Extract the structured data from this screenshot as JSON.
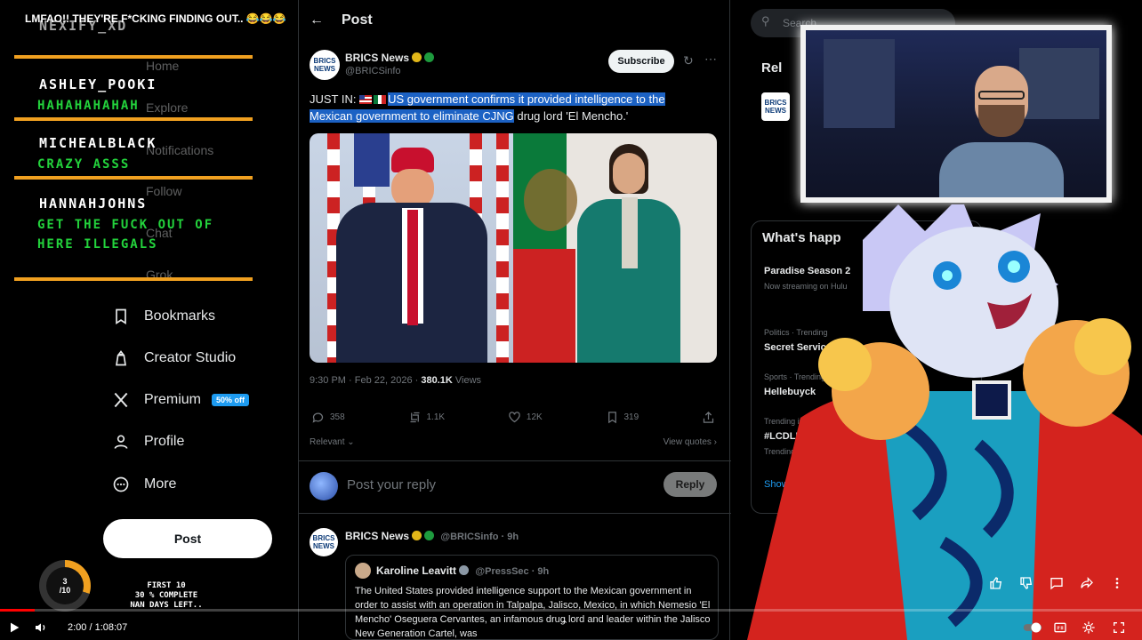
{
  "stream_title": "LMFAO!! THEY'RE F*CKING FINDING OUT.. 😂😂😂",
  "chat": {
    "header_name": "NEXIFY_XD",
    "messages": [
      {
        "user": "ASHLEY_POOKI",
        "text": "HAHAHAHAHAH"
      },
      {
        "user": "MICHEALBLACK",
        "text": "CRAZY ASSS"
      },
      {
        "user": "HANNAHJOHNS",
        "text": "GET THE FUCK OUT OF HERE ILLEGALS"
      }
    ],
    "accent_color": "#f0a020",
    "message_color": "#23d23c"
  },
  "sidebar": {
    "ghost_items": [
      "Home",
      "Explore",
      "Notifications",
      "Follow",
      "Chat",
      "Grok"
    ],
    "items": [
      {
        "label": "Bookmarks",
        "icon": "bookmark-icon"
      },
      {
        "label": "Creator Studio",
        "icon": "creator-studio-icon"
      },
      {
        "label": "Premium",
        "icon": "x-logo-icon",
        "badge": "50% off"
      },
      {
        "label": "Profile",
        "icon": "person-icon"
      },
      {
        "label": "More",
        "icon": "more-circle-icon"
      }
    ],
    "post_button": "Post"
  },
  "main": {
    "header_title": "Post",
    "post": {
      "author": "BRICS News",
      "handle": "@BRICSinfo",
      "subscribe": "Subscribe",
      "text_prefix": "JUST IN: ",
      "text_highlight": "US government confirms it provided intelligence to the Mexican government to eliminate CJNG",
      "text_suffix": " drug lord 'El Mencho.'",
      "time": "9:30 PM · Feb 22, 2026 · ",
      "views": "380.1K",
      "views_label": " Views",
      "replies": "358",
      "reposts": "1.1K",
      "likes": "12K",
      "bookmarks": "319",
      "relevant": "Relevant ⌄",
      "view_quotes": "View quotes ›"
    },
    "reply_placeholder": "Post your reply",
    "reply_button": "Reply",
    "second_post": {
      "author": "BRICS News",
      "handle": "@BRICSinfo · 9h",
      "quote_author": "Karoline Leavitt",
      "quote_handle": "@PressSec · 9h",
      "quote_text": "The United States provided intelligence support to the Mexican government in order to assist with an operation in Talpalpa, Jalisco, Mexico, in which Nemesio 'El Mencho' Oseguera Cervantes, an infamous drug lord and leader within the Jalisco New Generation Cartel, was"
    }
  },
  "right": {
    "search_placeholder": "Search",
    "relevant_head": "Rel",
    "whats_happening": "What's happ",
    "trends": [
      {
        "cat": "",
        "name": "Paradise Season 2",
        "sub": "Now streaming on Hulu"
      },
      {
        "cat": "Politics · Trending",
        "name": "Secret Service",
        "sub": ""
      },
      {
        "cat": "Sports · Trending",
        "name": "Hellebuyck",
        "sub": ""
      },
      {
        "cat": "Trending in United St",
        "name": "#LCDLF6",
        "sub": "Trending with"
      }
    ],
    "show_more": "Show more"
  },
  "goal": {
    "count": "3",
    "total": "/10",
    "percent": 30,
    "lines": [
      "FIRST 10",
      "30 % COMPLETE",
      "NAN DAYS LEFT.."
    ]
  },
  "player": {
    "time": "2:00 / 1:08:07",
    "progress": 0.03
  }
}
